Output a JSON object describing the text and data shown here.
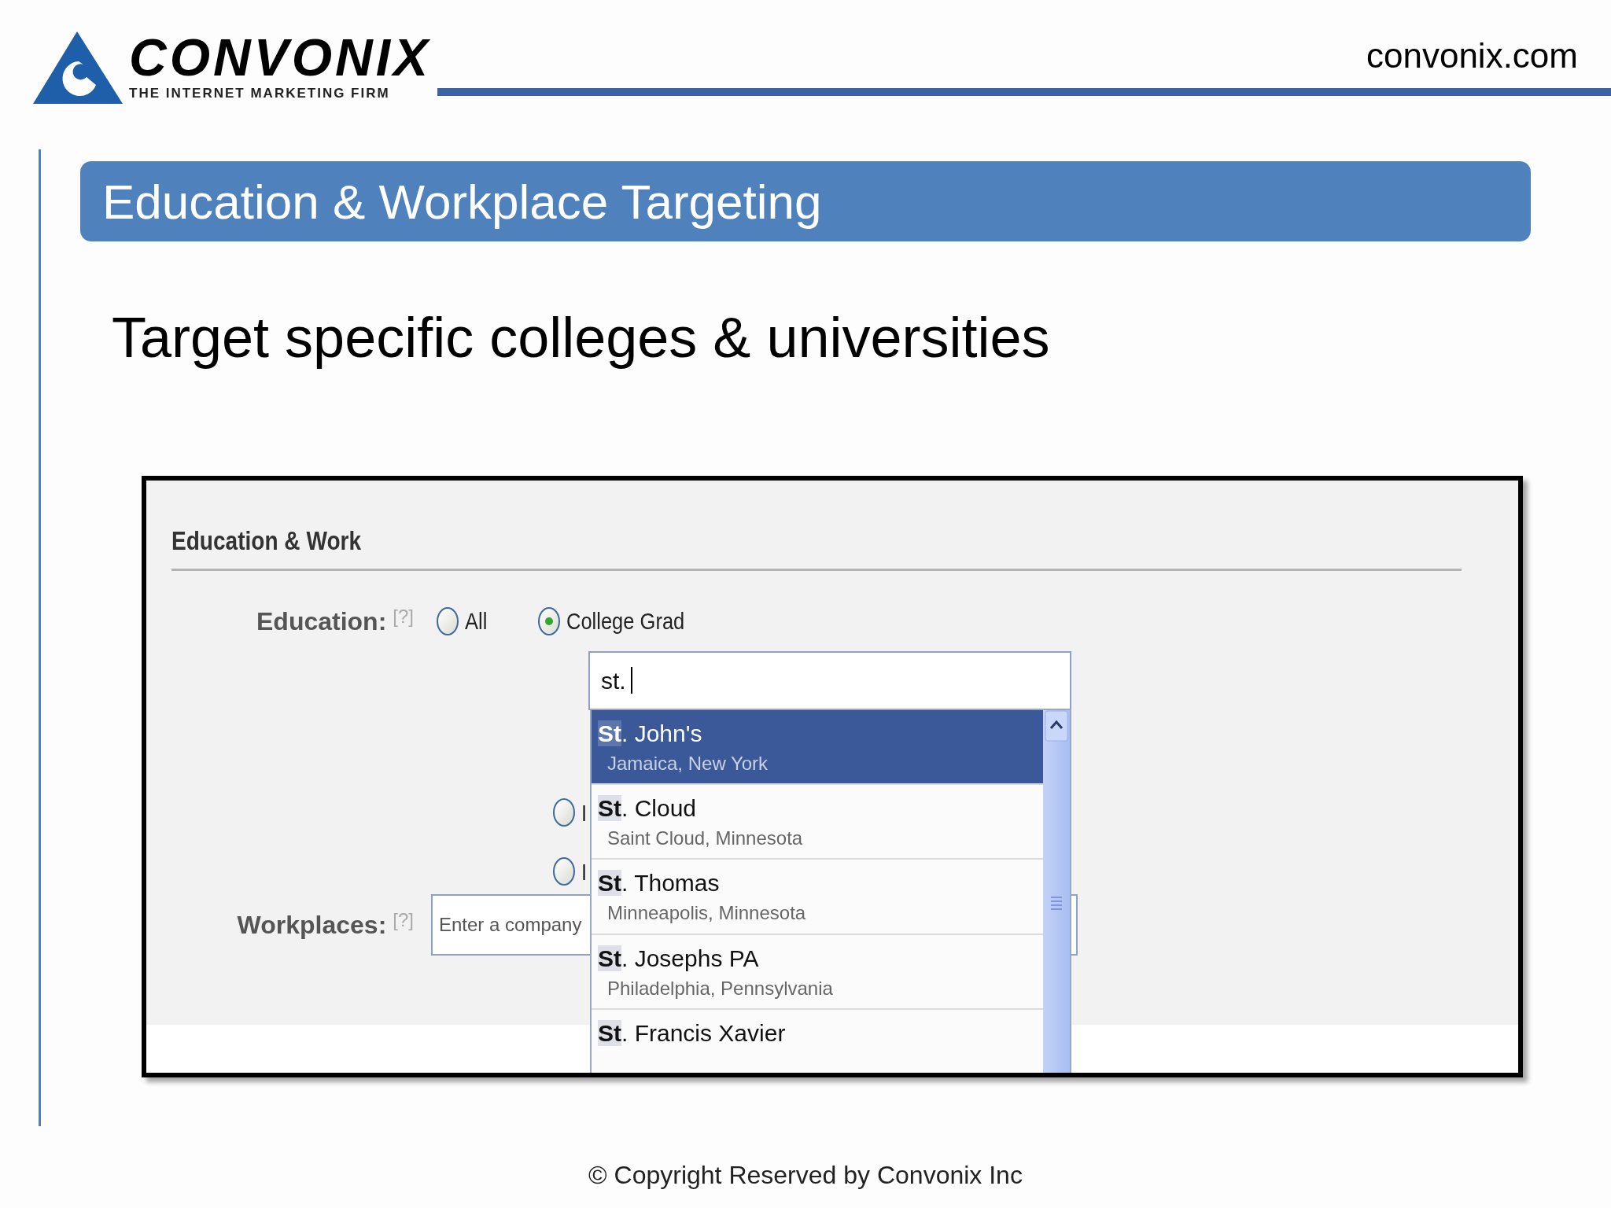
{
  "logo": {
    "wordmark": "CONVONIX",
    "tagline": "THE INTERNET MARKETING FIRM"
  },
  "site": "convonix.com",
  "title": "Education & Workplace Targeting",
  "subtitle": "Target specific colleges & universities",
  "screenshot": {
    "heading": "Education & Work",
    "education": {
      "label": "Education:",
      "help": "[?]",
      "options": [
        {
          "label": "All",
          "selected": false
        },
        {
          "label": "College Grad",
          "selected": true
        },
        {
          "label": "I",
          "selected": false
        },
        {
          "label": "I",
          "selected": false
        }
      ]
    },
    "school_field": {
      "value": "st."
    },
    "suggestions": [
      {
        "name": "**St**. John's",
        "place": "Jamaica, New York",
        "selected": true
      },
      {
        "name": "**St**. Cloud",
        "place": "Saint Cloud, Minnesota",
        "selected": false
      },
      {
        "name": "**St**. Thomas",
        "place": "Minneapolis, Minnesota",
        "selected": false
      },
      {
        "name": "**St**. Josephs PA",
        "place": "Philadelphia, Pennsylvania",
        "selected": false
      },
      {
        "name": "**St**. Francis Xavier",
        "selected": false
      }
    ],
    "workplaces": {
      "label": "Workplaces:",
      "help": "[?]",
      "placeholder": "Enter a company"
    }
  },
  "footer": "© Copyright Reserved by Convonix Inc"
}
